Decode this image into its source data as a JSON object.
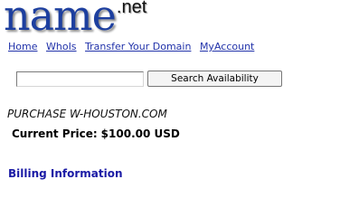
{
  "logo": {
    "main": "name",
    "tld": ".net"
  },
  "nav": {
    "items": [
      {
        "label": "Home"
      },
      {
        "label": "WhoIs"
      },
      {
        "label": "Transfer Your Domain"
      },
      {
        "label": "MyAccount"
      }
    ]
  },
  "search": {
    "value": "",
    "button_label": "Search Availability"
  },
  "purchase": {
    "title": "PURCHASE W-HOUSTON.COM",
    "price_label": "Current Price:",
    "price_value": "$100.00 USD"
  },
  "billing": {
    "heading": "Billing Information"
  },
  "colors": {
    "logo": "#1d3f9f",
    "link": "#2233aa",
    "billing": "#1a1aa5"
  }
}
